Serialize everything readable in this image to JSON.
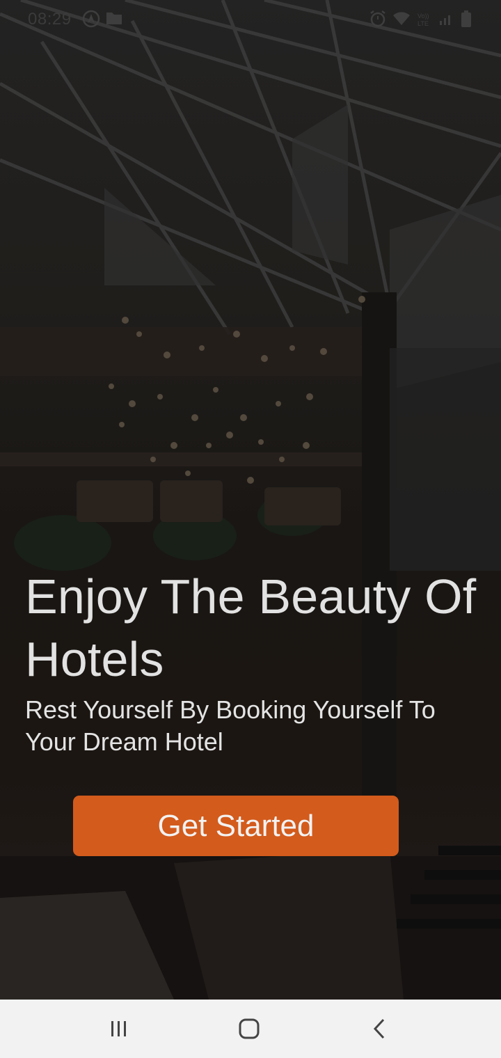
{
  "status_bar": {
    "time": "08:29",
    "icons": [
      "navigation-app-icon",
      "folder-icon",
      "alarm-icon",
      "wifi-icon",
      "volte-icon",
      "signal-icon",
      "battery-icon"
    ],
    "volte_label": "Vo))\nLTE"
  },
  "hero": {
    "title": "Enjoy The Beauty Of Hotels",
    "subtitle": "Rest Yourself By Booking Yourself To Your Dream Hotel",
    "background": "hotel-atrium-photo"
  },
  "cta": {
    "label": "Get Started"
  },
  "nav_bar": {
    "items": [
      "recent-apps-icon",
      "home-icon",
      "back-icon"
    ]
  },
  "colors": {
    "accent": "#d35b1c",
    "text": "#e2e2e2",
    "navbar_bg": "#f2f2f2"
  }
}
